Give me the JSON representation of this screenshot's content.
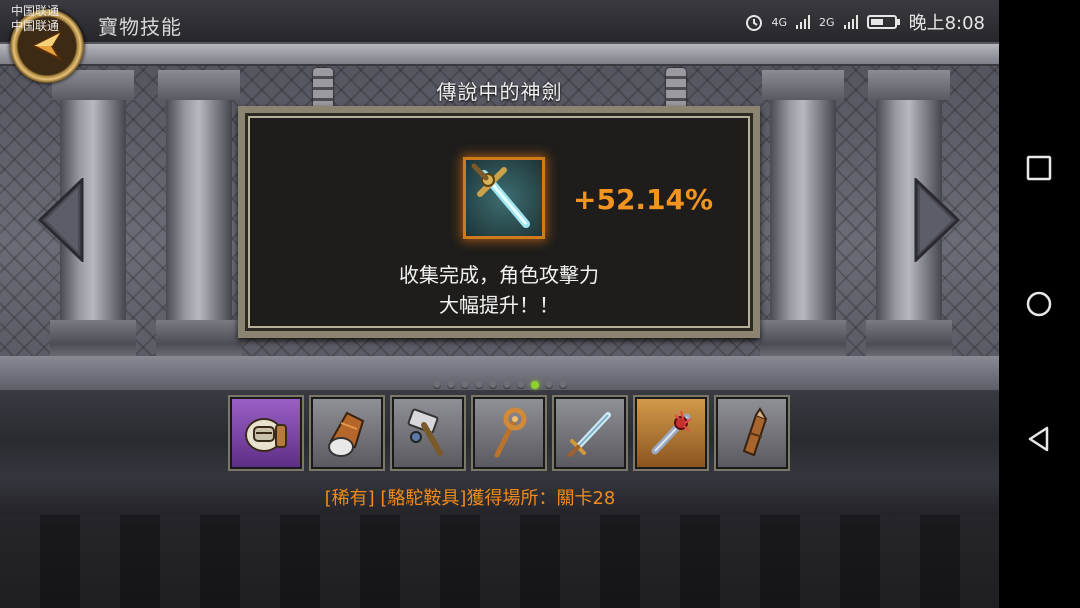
{
  "status_bar": {
    "carrier_1": "中国联通",
    "carrier_2": "中国联通",
    "network_1": "4G",
    "network_2": "2G",
    "time": "晚上8:08"
  },
  "header": {
    "title": "寶物技能"
  },
  "panel": {
    "title": "傳說中的神劍",
    "bonus": "+52.14%",
    "desc_line1": "收集完成，角色攻擊力",
    "desc_line2": "大幅提升！！"
  },
  "pager": {
    "total": 10,
    "active_index": 7
  },
  "items": [
    {
      "icon": "saddle-icon",
      "tier": "rare"
    },
    {
      "icon": "gauntlet-icon",
      "tier": "normal"
    },
    {
      "icon": "hammer-icon",
      "tier": "normal"
    },
    {
      "icon": "staff-icon",
      "tier": "normal"
    },
    {
      "icon": "sword-icon",
      "tier": "normal"
    },
    {
      "icon": "spiked-sword-icon",
      "tier": "selected"
    },
    {
      "icon": "quiver-icon",
      "tier": "normal"
    }
  ],
  "caption": "[稀有] [駱駝鞍具]獲得場所：關卡28",
  "colors": {
    "accent": "#f29520",
    "active_dot": "#8fd22e",
    "rare": "#7a45a8"
  }
}
